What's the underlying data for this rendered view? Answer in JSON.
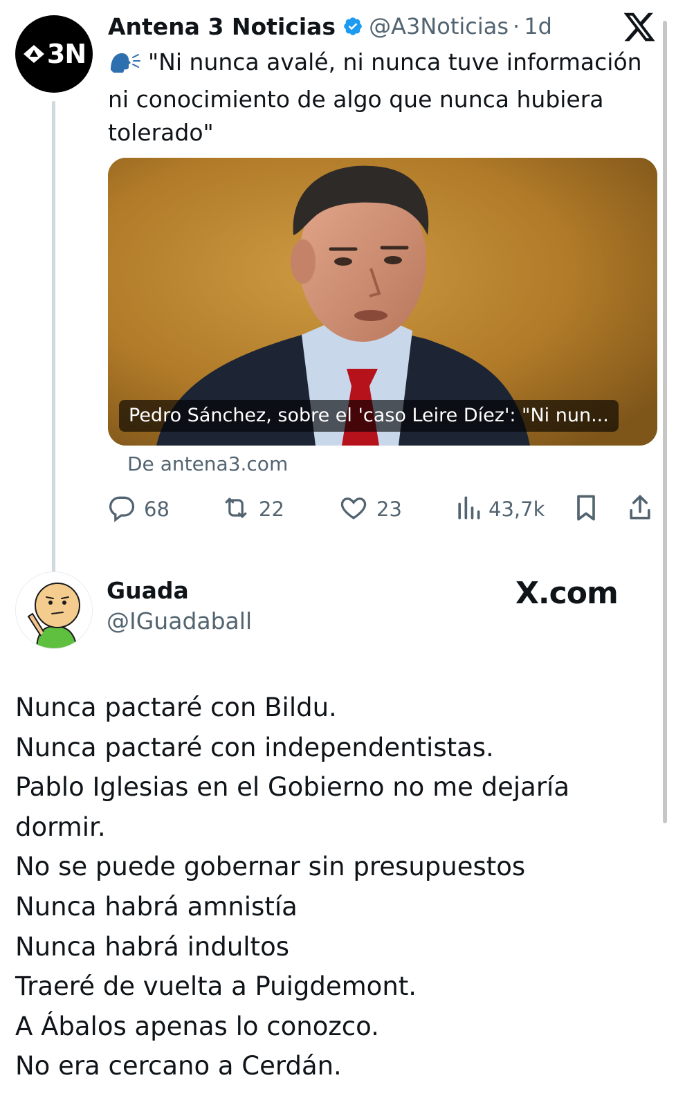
{
  "tweet": {
    "author": {
      "avatar_text": "3N",
      "display_name": "Antena 3 Noticias",
      "handle": "@A3Noticias",
      "separator": "·",
      "time": "1d",
      "verified_color": "#1d9bf0"
    },
    "emoji_icon": "speaking-head-icon",
    "text": "\"Ni nunca avalé, ni nunca tuve información ni conocimiento de algo que nunca hubiera tolerado\"",
    "card": {
      "caption": "Pedro Sánchez, sobre el 'caso Leire Díez': \"Ni nun...",
      "source": "De antena3.com"
    },
    "actions": {
      "replies": "68",
      "reposts": "22",
      "likes": "23",
      "views": "43,7k"
    }
  },
  "reply": {
    "display_name": "Guada",
    "handle": "@IGuadaball",
    "watermark": "X.com",
    "lines": [
      "Nunca pactaré con Bildu.",
      "Nunca pactaré con independentistas.",
      "Pablo Iglesias en el Gobierno no me dejaría",
      "dormir.",
      "No se puede gobernar sin presupuestos",
      "Nunca habrá amnistía",
      "Nunca habrá indultos",
      "Traeré de vuelta a Puigdemont.",
      "A Ábalos apenas lo conozco.",
      "No era cercano a Cerdán."
    ]
  },
  "colors": {
    "text": "#0f1419",
    "secondary": "#536471",
    "thread_line": "#cfd9de",
    "accent_blue": "#1d9bf0"
  }
}
